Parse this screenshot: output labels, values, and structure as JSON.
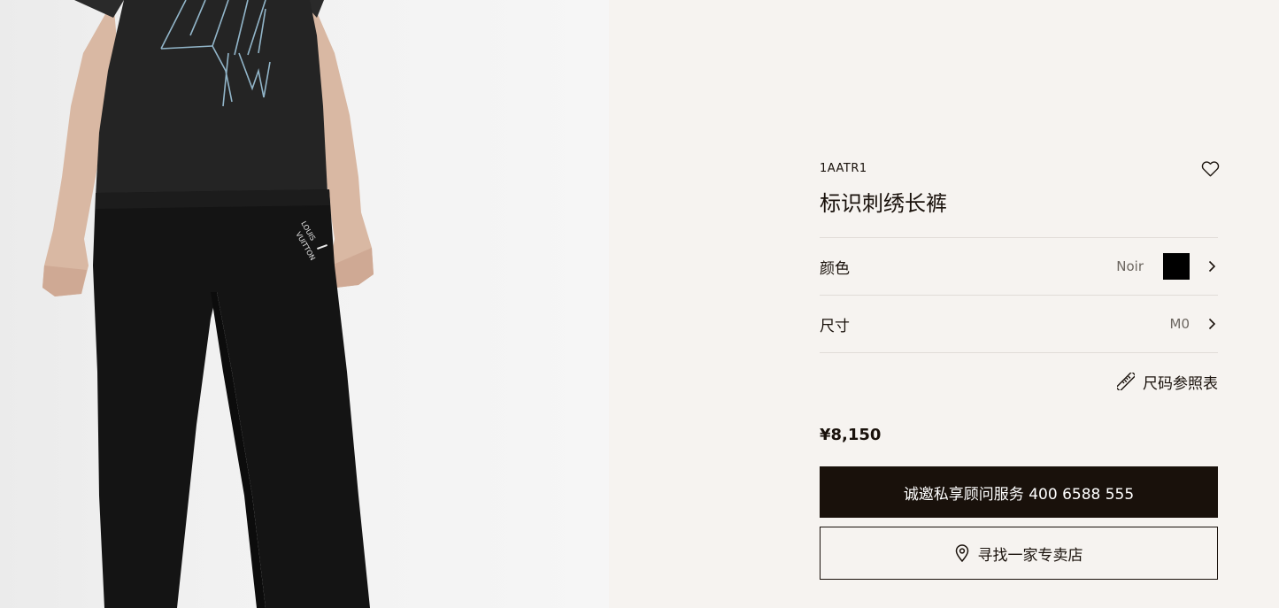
{
  "product": {
    "sku": "1AATR1",
    "title": "标识刺绣长裤",
    "price": "¥8,150"
  },
  "options": {
    "color": {
      "label": "颜色",
      "value": "Noir",
      "swatch_color": "#000000"
    },
    "size": {
      "label": "尺寸",
      "value": "M0"
    }
  },
  "size_guide_label": "尺码参照表",
  "actions": {
    "contact_label": "诚邀私享顾问服务 400 6588 555",
    "store_locator_label": "寻找一家专卖店"
  },
  "icons": {
    "wishlist": "heart-icon",
    "chevron": "chevron-right-icon",
    "size_guide": "ruler-icon",
    "store": "map-pin-icon"
  },
  "colors": {
    "primary": "#19110b",
    "background": "#f6f3f0",
    "divider": "#e1dcd8"
  }
}
